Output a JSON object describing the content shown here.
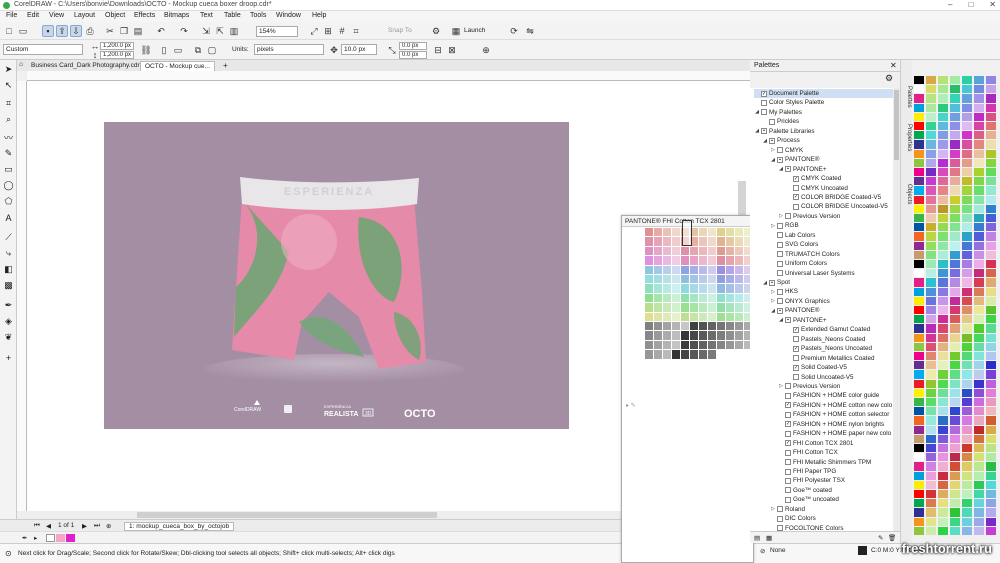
{
  "window": {
    "title": "CorelDRAW - C:\\Users\\bonvie\\Downloads\\OCTO - Mockup cueca boxer droop.cdr*",
    "controls": [
      "–",
      "□",
      "✕"
    ]
  },
  "menu": [
    "File",
    "Edit",
    "View",
    "Layout",
    "Object",
    "Effects",
    "Bitmaps",
    "Text",
    "Table",
    "Tools",
    "Window",
    "Help"
  ],
  "toolbar1": {
    "zoom": "154%",
    "snap_to": "Snap To",
    "launch": "Launch"
  },
  "toolbar2": {
    "preset": "Custom",
    "width": "1,200.0 px",
    "height": "1,200.0 px",
    "units_label": "Units:",
    "units_value": "pixels",
    "nudge": "10.0 px",
    "dup_x": "0.0 px",
    "dup_y": "0.0 px"
  },
  "doc_tabs": [
    {
      "label": "Business Card_Dark Photography.cdr",
      "active": false
    },
    {
      "label": "OCTO - Mockup cue...",
      "active": true
    }
  ],
  "artwork": {
    "waistband_text": "ESPERIENZA",
    "footer_logos": [
      "CorelDRAW",
      "realista 3D",
      "OCTO"
    ],
    "realista_small": "EXPERIÊNCIA",
    "realista_big": "REALISTA",
    "realista_badge": "3D"
  },
  "page_nav": {
    "page_of": "1 of 1",
    "page_tab": "1: mockup_cueca_box_by_octojob"
  },
  "status": "Next click for Drag/Scale; Second click for Rotate/Skew; Dbl-clicking tool selects all objects; Shift+ click multi-selects; Alt+ click digs",
  "pantone_popup": {
    "title": "PANTONE® FHI Cotton TCX 2801"
  },
  "palettes_panel": {
    "title": "Palettes",
    "tree": [
      {
        "label": "Document Palette",
        "level": 0,
        "twist": "",
        "check": "✓",
        "selected": true
      },
      {
        "label": "Color Styles Palette",
        "level": 0,
        "twist": "",
        "check": "",
        "selected": false
      },
      {
        "label": "My Palettes",
        "level": 0,
        "twist": "◢",
        "check": "",
        "selected": false
      },
      {
        "label": "Prickles",
        "level": 1,
        "twist": "",
        "check": "",
        "selected": false
      },
      {
        "label": "Palette Libraries",
        "level": 0,
        "twist": "◢",
        "check": "▪",
        "selected": false
      },
      {
        "label": "Process",
        "level": 1,
        "twist": "◢",
        "check": "▪",
        "selected": false
      },
      {
        "label": "CMYK",
        "level": 2,
        "twist": "▷",
        "check": "",
        "selected": false
      },
      {
        "label": "PANTONE®",
        "level": 2,
        "twist": "◢",
        "check": "▪",
        "selected": false
      },
      {
        "label": "PANTONE+",
        "level": 3,
        "twist": "◢",
        "check": "▪",
        "selected": false
      },
      {
        "label": "CMYK Coated",
        "level": 4,
        "twist": "",
        "check": "✓",
        "selected": false
      },
      {
        "label": "CMYK Uncoated",
        "level": 4,
        "twist": "",
        "check": "",
        "selected": false
      },
      {
        "label": "COLOR BRIDGE Coated-V5",
        "level": 4,
        "twist": "",
        "check": "✓",
        "selected": false
      },
      {
        "label": "COLOR BRIDGE Uncoated-V5",
        "level": 4,
        "twist": "",
        "check": "",
        "selected": false
      },
      {
        "label": "Previous Version",
        "level": 3,
        "twist": "▷",
        "check": "",
        "selected": false
      },
      {
        "label": "RGB",
        "level": 2,
        "twist": "▷",
        "check": "",
        "selected": false
      },
      {
        "label": "Lab Colors",
        "level": 2,
        "twist": "",
        "check": "",
        "selected": false
      },
      {
        "label": "SVG Colors",
        "level": 2,
        "twist": "",
        "check": "",
        "selected": false
      },
      {
        "label": "TRUMATCH Colors",
        "level": 2,
        "twist": "",
        "check": "",
        "selected": false
      },
      {
        "label": "Uniform Colors",
        "level": 2,
        "twist": "",
        "check": "",
        "selected": false
      },
      {
        "label": "Universal Laser Systems",
        "level": 2,
        "twist": "",
        "check": "",
        "selected": false
      },
      {
        "label": "Spot",
        "level": 1,
        "twist": "◢",
        "check": "▪",
        "selected": false
      },
      {
        "label": "HKS",
        "level": 2,
        "twist": "▷",
        "check": "",
        "selected": false
      },
      {
        "label": "ONYX Graphics",
        "level": 2,
        "twist": "▷",
        "check": "",
        "selected": false
      },
      {
        "label": "PANTONE®",
        "level": 2,
        "twist": "◢",
        "check": "▪",
        "selected": false
      },
      {
        "label": "PANTONE+",
        "level": 3,
        "twist": "◢",
        "check": "▪",
        "selected": false
      },
      {
        "label": "Extended Gamut Coated",
        "level": 4,
        "twist": "",
        "check": "✓",
        "selected": false
      },
      {
        "label": "Pastels_Neons Coated",
        "level": 4,
        "twist": "",
        "check": "",
        "selected": false
      },
      {
        "label": "Pastels_Neons Uncoated",
        "level": 4,
        "twist": "",
        "check": "✓",
        "selected": false
      },
      {
        "label": "Premium Metallics Coated",
        "level": 4,
        "twist": "",
        "check": "",
        "selected": false
      },
      {
        "label": "Solid Coated-V5",
        "level": 4,
        "twist": "",
        "check": "✓",
        "selected": false
      },
      {
        "label": "Solid Uncoated-V5",
        "level": 4,
        "twist": "",
        "check": "",
        "selected": false
      },
      {
        "label": "Previous Version",
        "level": 3,
        "twist": "▷",
        "check": "",
        "selected": false
      },
      {
        "label": "FASHION + HOME color guide",
        "level": 3,
        "twist": "",
        "check": "",
        "selected": false
      },
      {
        "label": "FASHION + HOME cotton new colo",
        "level": 3,
        "twist": "",
        "check": "✓",
        "selected": false
      },
      {
        "label": "FASHION + HOME cotton selector",
        "level": 3,
        "twist": "",
        "check": "",
        "selected": false
      },
      {
        "label": "FASHION + HOME nylon brights",
        "level": 3,
        "twist": "",
        "check": "✓",
        "selected": false
      },
      {
        "label": "FASHION + HOME paper new colo",
        "level": 3,
        "twist": "",
        "check": "",
        "selected": false
      },
      {
        "label": "FHI Cotton TCX 2801",
        "level": 3,
        "twist": "",
        "check": "✓",
        "selected": false
      },
      {
        "label": "FHI Cotton TCX",
        "level": 3,
        "twist": "",
        "check": "",
        "selected": false
      },
      {
        "label": "FHI Metallic Shimmers TPM",
        "level": 3,
        "twist": "",
        "check": "",
        "selected": false
      },
      {
        "label": "FHI Paper TPG",
        "level": 3,
        "twist": "",
        "check": "",
        "selected": false
      },
      {
        "label": "FHI Polyester TSX",
        "level": 3,
        "twist": "",
        "check": "",
        "selected": false
      },
      {
        "label": "Goe™ coated",
        "level": 3,
        "twist": "",
        "check": "",
        "selected": false
      },
      {
        "label": "Goe™ uncoated",
        "level": 3,
        "twist": "",
        "check": "",
        "selected": false
      },
      {
        "label": "Roland",
        "level": 2,
        "twist": "▷",
        "check": "",
        "selected": false
      },
      {
        "label": "DIC Colors",
        "level": 2,
        "twist": "",
        "check": "",
        "selected": false
      },
      {
        "label": "FOCOLTONE Colors",
        "level": 2,
        "twist": "",
        "check": "",
        "selected": false
      }
    ],
    "fill_label": "None",
    "outline_label": "C:0 M:0 Y:0 K:100"
  },
  "side_tabs": [
    "Palettes",
    "Properties",
    "Objects"
  ],
  "watermark": "freshtorrent.ru",
  "colors": {
    "artboard_bg": "#a48ea4",
    "accent": "#c8d8ec",
    "selection": "#cfe0f4",
    "shorts_pink": "#e58aa8",
    "shorts_green": "#6fa473",
    "waistband": "#e8e6e8"
  }
}
